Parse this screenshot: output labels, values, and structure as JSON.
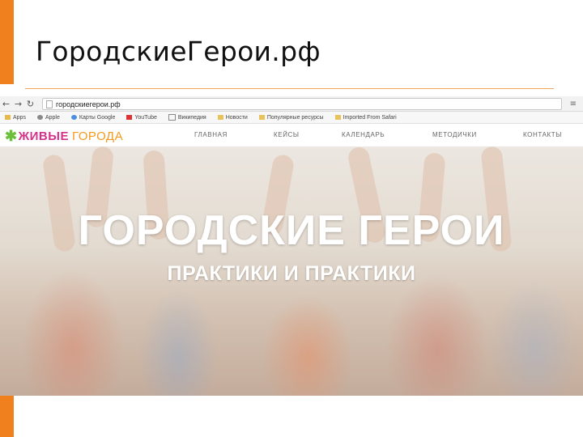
{
  "slide": {
    "title": "ГородскиеГерои.рф",
    "accent_color": "#f07f1e"
  },
  "browser": {
    "url": "городскиегерои.рф",
    "bookmarks": [
      {
        "label": "Apps",
        "icon": "apps-icon"
      },
      {
        "label": "Apple",
        "icon": "apple-icon"
      },
      {
        "label": "Карты Google",
        "icon": "maps-icon"
      },
      {
        "label": "YouTube",
        "icon": "youtube-icon"
      },
      {
        "label": "Википедия",
        "icon": "wikipedia-icon"
      },
      {
        "label": "Новости",
        "icon": "folder-icon"
      },
      {
        "label": "Популярные ресурсы",
        "icon": "folder-icon"
      },
      {
        "label": "Imported From Safari",
        "icon": "folder-icon"
      }
    ]
  },
  "site": {
    "logo_part1": "ЖИВЫЕ",
    "logo_part2": "ГОРОДА",
    "nav": [
      "ГЛАВНАЯ",
      "КЕЙСЫ",
      "КАЛЕНДАРЬ",
      "МЕТОДИЧКИ",
      "КОНТАКТЫ"
    ],
    "hero_title": "ГОРОДСКИЕ ГЕРОИ",
    "hero_subtitle": "ПРАКТИКИ И ПРАКТИКИ"
  }
}
